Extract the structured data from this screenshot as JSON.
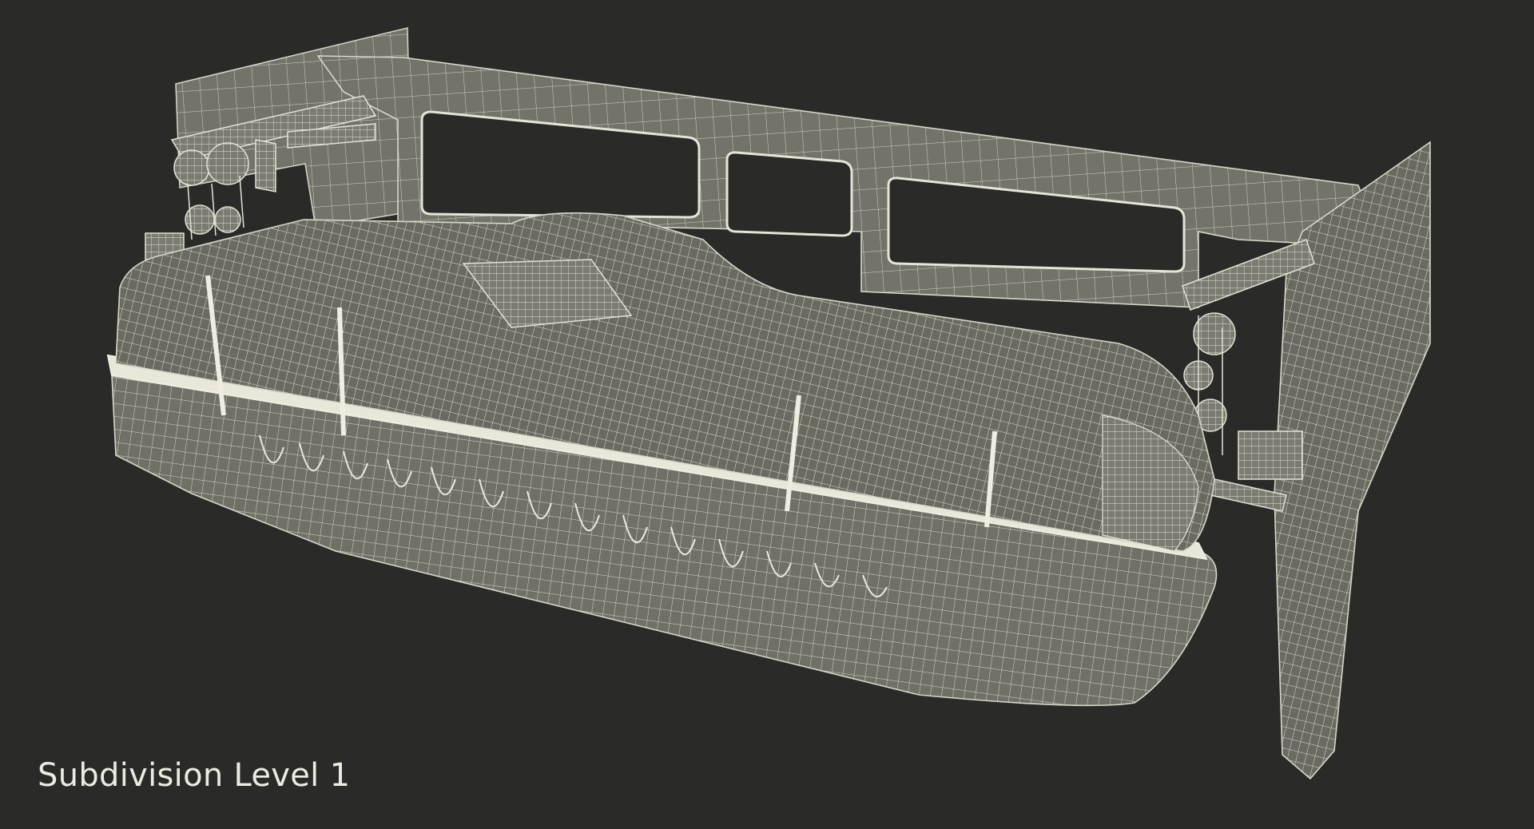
{
  "viewport": {
    "background_color": "#2a2a29",
    "caption": "Subdivision Level 1"
  },
  "model": {
    "subject": "lifeboat-with-davit-frame-wireframe",
    "wire_color": "#d8d6c8",
    "surface_color": "#6e6e64"
  }
}
